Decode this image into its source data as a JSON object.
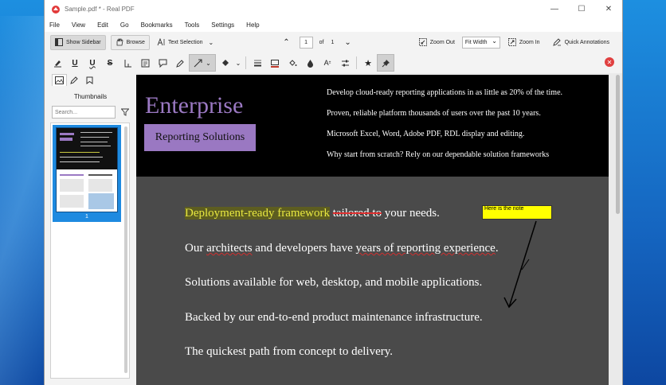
{
  "window": {
    "title": "Sample.pdf * - Real PDF"
  },
  "menu": [
    "File",
    "View",
    "Edit",
    "Go",
    "Bookmarks",
    "Tools",
    "Settings",
    "Help"
  ],
  "toolbar": {
    "show_sidebar": "Show Sidebar",
    "browse": "Browse",
    "text_selection": "Text Selection",
    "page_number": "1",
    "page_of": "of",
    "page_total": "1",
    "zoom_out": "Zoom Out",
    "zoom_mode": "Fit Width",
    "zoom_in": "Zoom In",
    "quick_annotations": "Quick Annotations"
  },
  "sidebar": {
    "title": "Thumbnails",
    "search_placeholder": "Search...",
    "thumb_page_num": "1"
  },
  "document": {
    "header_title": "Enterprise",
    "header_subtitle": "Reporting Solutions",
    "header_lines": [
      "Develop cloud-ready reporting applications in as little as 20% of the time.",
      "Proven, reliable platform thousands of users over the past 10 years.",
      "Microsoft Excel, Word, Adobe PDF, RDL display and editing.",
      "Why start from scratch? Rely on our dependable solution frameworks"
    ],
    "line1_highlight": "Deployment-ready framework",
    "line1_strike": "tailored to",
    "line1_rest": "your needs.",
    "line2_a": "Our ",
    "line2_architects": "architects",
    "line2_b": " and developers have ",
    "line2_years": "years of reporting experience",
    "line2_c": ".",
    "line3": "Solutions available for web, desktop, and mobile applications.",
    "line4": "Backed by our end-to-end product maintenance infrastructure.",
    "line5": "The quickest path from concept to delivery.",
    "note_text": "Here is the note"
  },
  "colors": {
    "accent_purple": "#9b79c3",
    "highlight": "#e8e840",
    "note": "#ffff00",
    "strike": "#e03030"
  }
}
